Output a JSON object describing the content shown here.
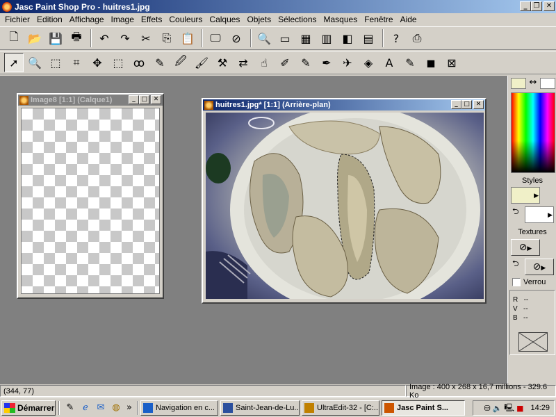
{
  "window": {
    "title": "Jasc Paint Shop Pro - huitres1.jpg"
  },
  "menu": [
    "Fichier",
    "Edition",
    "Affichage",
    "Image",
    "Effets",
    "Couleurs",
    "Calques",
    "Objets",
    "Sélections",
    "Masques",
    "Fenêtre",
    "Aide"
  ],
  "toolbar1": [
    {
      "icon": "new-file-icon",
      "glyph": "🗋"
    },
    {
      "icon": "open-folder-icon",
      "glyph": "📂"
    },
    {
      "icon": "save-icon",
      "glyph": "💾"
    },
    {
      "icon": "print-icon",
      "glyph": "🖶"
    },
    {
      "sep": true
    },
    {
      "icon": "undo-icon",
      "glyph": "↶"
    },
    {
      "icon": "redo-icon",
      "glyph": "↷"
    },
    {
      "icon": "cut-icon",
      "glyph": "✂"
    },
    {
      "icon": "copy-icon",
      "glyph": "⎘"
    },
    {
      "icon": "paste-icon",
      "glyph": "📋"
    },
    {
      "sep": true
    },
    {
      "icon": "full-screen-preview-icon",
      "glyph": "🖵"
    },
    {
      "icon": "cancel-icon",
      "glyph": "⊘"
    },
    {
      "sep": true
    },
    {
      "icon": "overview-icon",
      "glyph": "🔍"
    },
    {
      "icon": "tool-options-icon",
      "glyph": "▭"
    },
    {
      "icon": "color-palette-icon",
      "glyph": "▦"
    },
    {
      "icon": "histogram-icon",
      "glyph": "▥"
    },
    {
      "icon": "layer-palette-icon",
      "glyph": "◧"
    },
    {
      "icon": "window-icon",
      "glyph": "▤"
    },
    {
      "sep": true
    },
    {
      "icon": "help-icon",
      "glyph": "?"
    },
    {
      "icon": "scanner-icon",
      "glyph": "⎙"
    }
  ],
  "toolbar2": [
    {
      "icon": "arrow-tool-icon",
      "glyph": "➚",
      "active": true
    },
    {
      "icon": "zoom-tool-icon",
      "glyph": "🔍"
    },
    {
      "icon": "deform-tool-icon",
      "glyph": "⬚"
    },
    {
      "icon": "crop-tool-icon",
      "glyph": "⌗"
    },
    {
      "icon": "move-tool-icon",
      "glyph": "✥"
    },
    {
      "icon": "selection-tool-icon",
      "glyph": "⬚"
    },
    {
      "icon": "freehand-selection-icon",
      "glyph": "ꝏ"
    },
    {
      "icon": "magic-wand-icon",
      "glyph": "✎"
    },
    {
      "icon": "dropper-icon",
      "glyph": "🖉"
    },
    {
      "icon": "paintbrush-icon",
      "glyph": "🖌"
    },
    {
      "icon": "clone-brush-icon",
      "glyph": "⚒"
    },
    {
      "icon": "color-replacer-icon",
      "glyph": "⇄"
    },
    {
      "icon": "retouch-icon",
      "glyph": "☝"
    },
    {
      "icon": "scratch-remover-icon",
      "glyph": "✐"
    },
    {
      "icon": "eraser-icon",
      "glyph": "✎"
    },
    {
      "icon": "picture-tube-icon",
      "glyph": "✒"
    },
    {
      "icon": "airbrush-icon",
      "glyph": "✈"
    },
    {
      "icon": "flood-fill-icon",
      "glyph": "◈"
    },
    {
      "icon": "text-tool-icon",
      "glyph": "A"
    },
    {
      "icon": "draw-tool-icon",
      "glyph": "✎"
    },
    {
      "icon": "preset-shapes-icon",
      "glyph": "◼"
    },
    {
      "icon": "vector-object-icon",
      "glyph": "⊠"
    }
  ],
  "doc1": {
    "title": "Image8 [1:1] (Calque1)"
  },
  "doc2": {
    "title": "huitres1.jpg* [1:1] (Arrière-plan)"
  },
  "palette": {
    "fg_color": "#f0f0c8",
    "bg_color": "#ffffff",
    "swap_glyph": "↔",
    "styles_label": "Styles",
    "textures_label": "Textures",
    "lock_label": "Verrou",
    "r_label": "R",
    "v_label": "V",
    "b_label": "B",
    "r_value": "--",
    "v_value": "--",
    "b_value": "--"
  },
  "status": {
    "coords": "(344, 77)",
    "info": "Image : 400 x 268 x 16,7 millions - 329.6 Ko"
  },
  "taskbar": {
    "start": "Démarrer",
    "tasks": [
      {
        "label": "Navigation en c...",
        "icon": "ie-icon"
      },
      {
        "label": "Saint-Jean-de-Lu...",
        "icon": "word-icon"
      },
      {
        "label": "UltraEdit-32 - [C:...",
        "icon": "ultraedit-icon"
      },
      {
        "label": "Jasc Paint S...",
        "icon": "psp-icon",
        "active": true
      }
    ],
    "clock": "14:29",
    "ql_more": "»"
  }
}
